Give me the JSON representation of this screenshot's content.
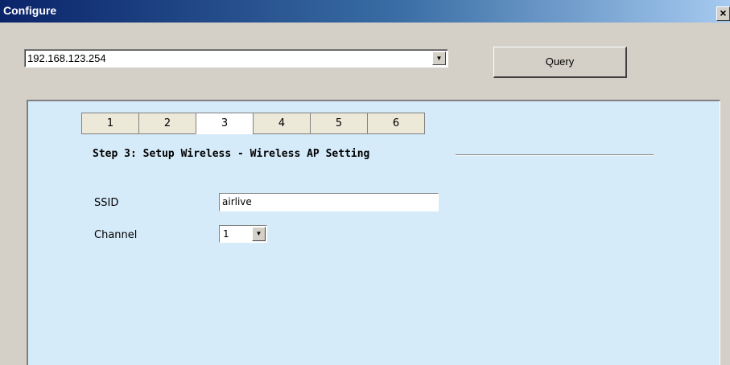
{
  "window": {
    "title": "Configure",
    "close_glyph": "×"
  },
  "toolbar": {
    "ip_value": "192.168.123.254",
    "dropdown_glyph": "▼",
    "query_label": "Query"
  },
  "wizard": {
    "tabs": [
      {
        "label": "1"
      },
      {
        "label": "2"
      },
      {
        "label": "3"
      },
      {
        "label": "4"
      },
      {
        "label": "5"
      },
      {
        "label": "6"
      }
    ],
    "active_tab": 3,
    "step_title": "Step 3: Setup Wireless - Wireless AP Setting"
  },
  "form": {
    "ssid_label": "SSID",
    "ssid_value": "airlive",
    "channel_label": "Channel",
    "channel_value": "1",
    "channel_dropdown_glyph": "▼"
  },
  "colors": {
    "panel_bg": "#d6ebfa",
    "window_bg": "#d4d0c8",
    "title_bar_start": "#0a246a"
  }
}
